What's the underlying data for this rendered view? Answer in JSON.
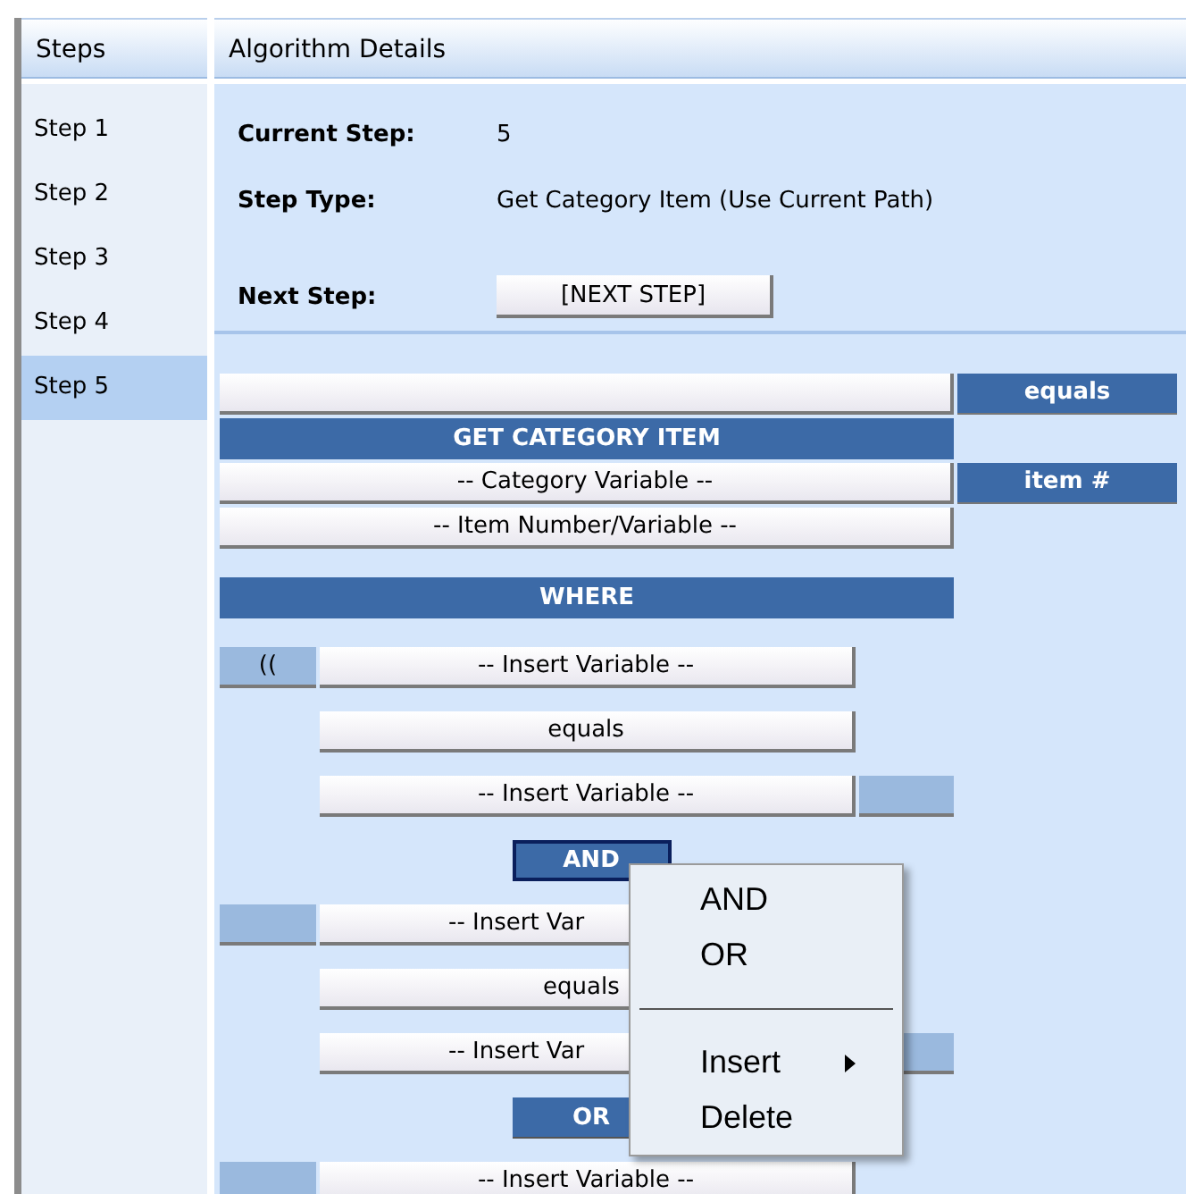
{
  "steps_panel": {
    "title": "Steps",
    "items": [
      {
        "label": "Step 1",
        "selected": false
      },
      {
        "label": "Step 2",
        "selected": false
      },
      {
        "label": "Step 3",
        "selected": false
      },
      {
        "label": "Step 4",
        "selected": false
      },
      {
        "label": "Step 5",
        "selected": true
      }
    ]
  },
  "details_panel": {
    "title": "Algorithm Details",
    "fields": [
      {
        "kind": "text",
        "label": "Current Step:",
        "value": "5"
      },
      {
        "kind": "text",
        "label": "Step Type:",
        "value": "Get Category Item (Use Current Path)"
      },
      {
        "kind": "button",
        "label": "Next Step:",
        "value": "[NEXT STEP]"
      }
    ]
  },
  "builder": {
    "sections": [
      {
        "rows": [
          {
            "kind": "select_row",
            "tag": "equals"
          },
          {
            "kind": "heading",
            "text": "GET CATEGORY ITEM"
          },
          {
            "kind": "select_row",
            "text": "-- Category Variable --",
            "tag": "item #"
          },
          {
            "kind": "select_row",
            "text": "-- Item Number/Variable --"
          }
        ]
      },
      {
        "rows": [
          {
            "kind": "heading",
            "text": "WHERE"
          }
        ]
      },
      {
        "rows": [
          {
            "kind": "condition",
            "left_box": true,
            "left_text": "((",
            "text": "-- Insert Variable --",
            "right_box": false,
            "cut": false
          },
          {
            "kind": "operator",
            "text": "equals",
            "cut": false
          },
          {
            "kind": "condition",
            "left_box": false,
            "text": "-- Insert Variable --",
            "right_box": true,
            "cut": false
          },
          {
            "kind": "connector",
            "text": "AND",
            "selected": true
          },
          {
            "kind": "condition",
            "left_box": true,
            "text": "-- Insert Var",
            "right_box": false,
            "cut": true
          },
          {
            "kind": "operator",
            "text": "equals",
            "cut": true
          },
          {
            "kind": "condition",
            "left_box": false,
            "text": "-- Insert Var",
            "right_box": true,
            "cut": true
          },
          {
            "kind": "connector",
            "text": "OR",
            "selected": false
          },
          {
            "kind": "condition",
            "left_box": true,
            "text": "-- Insert Variable --",
            "right_box": false,
            "cut": false
          }
        ]
      }
    ]
  },
  "context_menu": {
    "items": [
      {
        "kind": "item",
        "label": "AND"
      },
      {
        "kind": "item",
        "label": "OR"
      },
      {
        "kind": "separator"
      },
      {
        "kind": "submenu",
        "label": "Insert"
      },
      {
        "kind": "item",
        "label": "Delete"
      }
    ]
  }
}
